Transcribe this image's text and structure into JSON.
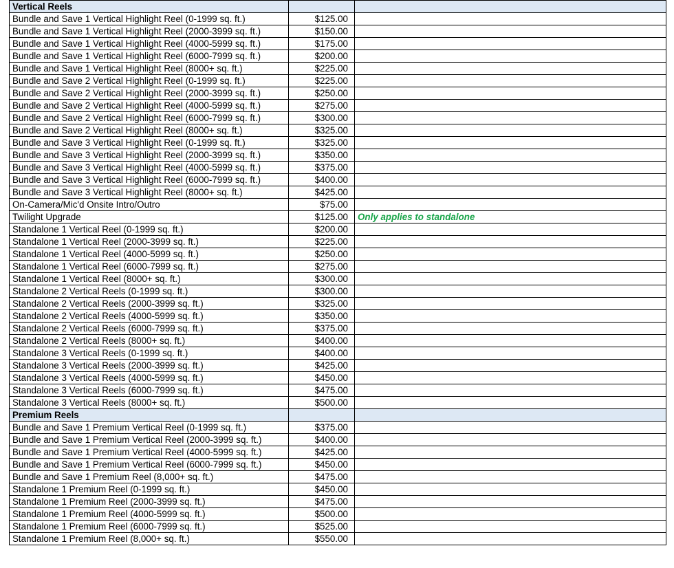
{
  "sections": [
    {
      "title": "Vertical Reels",
      "rows": [
        {
          "item": "Bundle and Save 1 Vertical Highlight Reel (0-1999 sq. ft.)",
          "price": "$125.00",
          "note": ""
        },
        {
          "item": "Bundle and Save 1 Vertical Highlight Reel (2000-3999 sq. ft.)",
          "price": "$150.00",
          "note": ""
        },
        {
          "item": "Bundle and Save 1 Vertical Highlight Reel (4000-5999 sq. ft.)",
          "price": "$175.00",
          "note": ""
        },
        {
          "item": "Bundle and Save 1 Vertical Highlight Reel (6000-7999 sq. ft.)",
          "price": "$200.00",
          "note": ""
        },
        {
          "item": "Bundle and Save 1 Vertical Highlight Reel (8000+ sq. ft.)",
          "price": "$225.00",
          "note": ""
        },
        {
          "item": "Bundle and Save 2 Vertical Highlight Reel (0-1999 sq. ft.)",
          "price": "$225.00",
          "note": ""
        },
        {
          "item": "Bundle and Save 2 Vertical Highlight Reel (2000-3999 sq. ft.)",
          "price": "$250.00",
          "note": ""
        },
        {
          "item": "Bundle and Save 2 Vertical Highlight Reel (4000-5999 sq. ft.)",
          "price": "$275.00",
          "note": ""
        },
        {
          "item": "Bundle and Save 2 Vertical Highlight Reel (6000-7999 sq. ft.)",
          "price": "$300.00",
          "note": ""
        },
        {
          "item": "Bundle and Save 2 Vertical Highlight Reel (8000+ sq. ft.)",
          "price": "$325.00",
          "note": ""
        },
        {
          "item": "Bundle and Save 3 Vertical Highlight Reel (0-1999 sq. ft.)",
          "price": "$325.00",
          "note": ""
        },
        {
          "item": "Bundle and Save 3 Vertical Highlight Reel (2000-3999 sq. ft.)",
          "price": "$350.00",
          "note": ""
        },
        {
          "item": "Bundle and Save 3 Vertical Highlight Reel (4000-5999 sq. ft.)",
          "price": "$375.00",
          "note": ""
        },
        {
          "item": "Bundle and Save 3 Vertical Highlight Reel (6000-7999 sq. ft.)",
          "price": "$400.00",
          "note": ""
        },
        {
          "item": "Bundle and Save 3 Vertical Highlight Reel (8000+ sq. ft.)",
          "price": "$425.00",
          "note": ""
        },
        {
          "item": "On-Camera/Mic'd Onsite Intro/Outro",
          "price": "$75.00",
          "note": ""
        },
        {
          "item": "Twilight Upgrade",
          "price": "$125.00",
          "note": "Only applies to standalone"
        },
        {
          "item": "Standalone 1 Vertical Reel (0-1999 sq. ft.)",
          "price": "$200.00",
          "note": ""
        },
        {
          "item": "Standalone 1 Vertical Reel (2000-3999 sq. ft.)",
          "price": "$225.00",
          "note": ""
        },
        {
          "item": "Standalone 1 Vertical Reel (4000-5999 sq. ft.)",
          "price": "$250.00",
          "note": ""
        },
        {
          "item": "Standalone 1 Vertical Reel (6000-7999 sq. ft.)",
          "price": "$275.00",
          "note": ""
        },
        {
          "item": "Standalone 1 Vertical Reel (8000+ sq. ft.)",
          "price": "$300.00",
          "note": ""
        },
        {
          "item": "Standalone 2 Vertical Reels (0-1999 sq. ft.)",
          "price": "$300.00",
          "note": ""
        },
        {
          "item": "Standalone 2 Vertical Reels (2000-3999 sq. ft.)",
          "price": "$325.00",
          "note": ""
        },
        {
          "item": "Standalone 2 Vertical Reels (4000-5999 sq. ft.)",
          "price": "$350.00",
          "note": ""
        },
        {
          "item": "Standalone 2 Vertical Reels (6000-7999 sq. ft.)",
          "price": "$375.00",
          "note": ""
        },
        {
          "item": "Standalone 2 Vertical Reels (8000+ sq. ft.)",
          "price": "$400.00",
          "note": ""
        },
        {
          "item": "Standalone 3 Vertical Reels (0-1999 sq. ft.)",
          "price": "$400.00",
          "note": ""
        },
        {
          "item": "Standalone 3 Vertical Reels (2000-3999 sq. ft.)",
          "price": "$425.00",
          "note": ""
        },
        {
          "item": "Standalone 3 Vertical Reels (4000-5999 sq. ft.)",
          "price": "$450.00",
          "note": ""
        },
        {
          "item": "Standalone 3 Vertical Reels (6000-7999 sq. ft.)",
          "price": "$475.00",
          "note": ""
        },
        {
          "item": "Standalone 3 Vertical Reels (8000+ sq. ft.)",
          "price": "$500.00",
          "note": ""
        }
      ]
    },
    {
      "title": "Premium Reels",
      "rows": [
        {
          "item": "Bundle and Save 1 Premium Vertical Reel (0-1999 sq. ft.)",
          "price": "$375.00",
          "note": ""
        },
        {
          "item": "Bundle and Save 1 Premium Vertical Reel (2000-3999 sq. ft.)",
          "price": "$400.00",
          "note": ""
        },
        {
          "item": "Bundle and Save 1 Premium Vertical Reel (4000-5999 sq. ft.)",
          "price": "$425.00",
          "note": ""
        },
        {
          "item": "Bundle and Save 1 Premium Vertical Reel (6000-7999 sq. ft.)",
          "price": "$450.00",
          "note": ""
        },
        {
          "item": "Bundle and Save 1 Premium Reel (8,000+ sq. ft.)",
          "price": "$475.00",
          "note": ""
        },
        {
          "item": "Standalone 1 Premium Reel (0-1999 sq. ft.)",
          "price": "$450.00",
          "note": ""
        },
        {
          "item": "Standalone 1 Premium Reel (2000-3999 sq. ft.)",
          "price": "$475.00",
          "note": ""
        },
        {
          "item": "Standalone 1 Premium Reel (4000-5999 sq. ft.)",
          "price": "$500.00",
          "note": ""
        },
        {
          "item": "Standalone 1 Premium Reel (6000-7999 sq. ft.)",
          "price": "$525.00",
          "note": ""
        },
        {
          "item": "Standalone 1 Premium Reel (8,000+ sq. ft.)",
          "price": "$550.00",
          "note": ""
        }
      ]
    }
  ],
  "colors": {
    "section_header_bg": "#dde8f4",
    "note_text": "#1aa54a",
    "grid_border": "#000000"
  }
}
